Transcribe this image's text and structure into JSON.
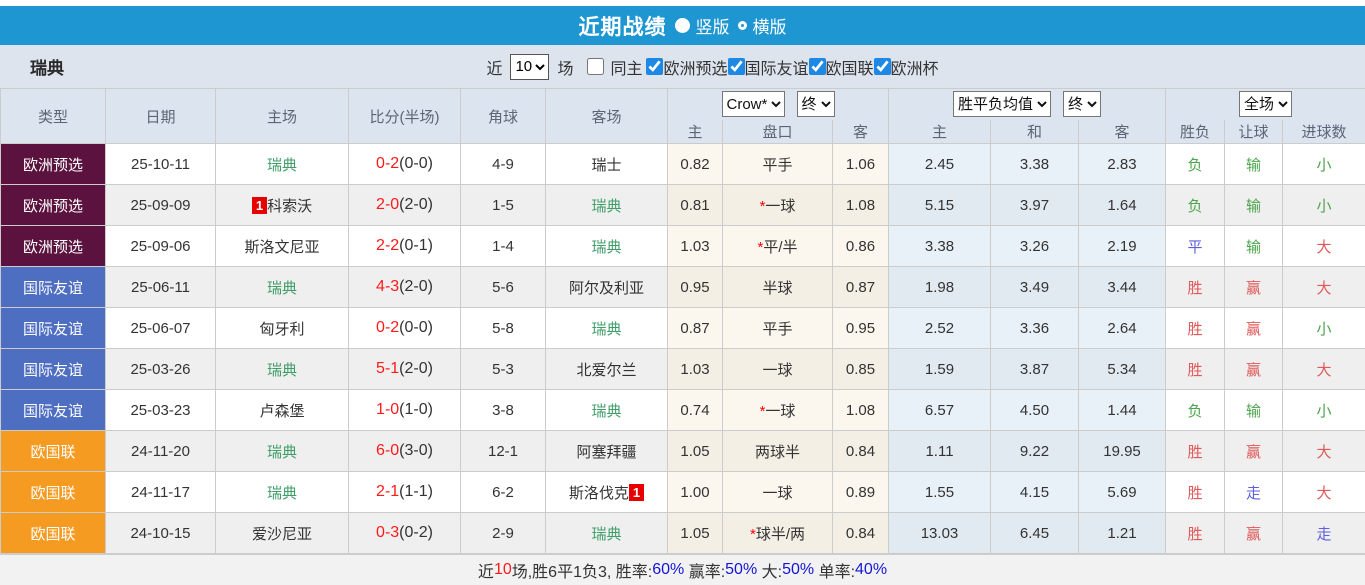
{
  "titlebar": {
    "title": "近期战绩",
    "options": [
      {
        "label": "竖版",
        "selected": true
      },
      {
        "label": "横版",
        "selected": false
      }
    ]
  },
  "filterbar": {
    "team": "瑞典",
    "recent_label": "近",
    "recent_value": "10",
    "matches_label": "场",
    "same_home": {
      "label": "同主",
      "checked": false
    },
    "competitions": [
      {
        "label": "欧洲预选",
        "checked": true
      },
      {
        "label": "国际友谊",
        "checked": true
      },
      {
        "label": "欧国联",
        "checked": true
      },
      {
        "label": "欧洲杯",
        "checked": true
      }
    ]
  },
  "table": {
    "main_headers": [
      "类型",
      "日期",
      "主场",
      "比分(半场)",
      "角球",
      "客场"
    ],
    "selects": {
      "company": "Crow*",
      "time1": "终",
      "avg": "胜平负均值",
      "time2": "终",
      "scope": "全场"
    },
    "sub_headers": [
      "主",
      "盘口",
      "客",
      "主",
      "和",
      "客",
      "胜负",
      "让球",
      "进球数"
    ],
    "type_colors": {
      "欧洲预选": "#5b123e",
      "国际友谊": "#4e6ec2",
      "欧国联": "#f59b22"
    },
    "rows": [
      {
        "type": "欧洲预选",
        "date": "25-10-11",
        "home": {
          "name": "瑞典",
          "green": true,
          "badge": null
        },
        "score": "0-2",
        "half": "(0-0)",
        "corner": "4-9",
        "away": {
          "name": "瑞士",
          "green": false,
          "badge": null
        },
        "odds_home": "0.82",
        "handicap": {
          "star": false,
          "text": "平手"
        },
        "odds_away": "1.06",
        "avg": [
          "2.45",
          "3.38",
          "2.83"
        ],
        "results": [
          {
            "t": "负",
            "c": "green"
          },
          {
            "t": "输",
            "c": "green"
          },
          {
            "t": "小",
            "c": "green"
          }
        ]
      },
      {
        "type": "欧洲预选",
        "date": "25-09-09",
        "home": {
          "name": "科索沃",
          "green": false,
          "badge": {
            "text": "1",
            "pos": "before"
          }
        },
        "score": "2-0",
        "half": "(2-0)",
        "corner": "1-5",
        "away": {
          "name": "瑞典",
          "green": true,
          "badge": null
        },
        "odds_home": "0.81",
        "handicap": {
          "star": true,
          "text": "一球"
        },
        "odds_away": "1.08",
        "avg": [
          "5.15",
          "3.97",
          "1.64"
        ],
        "results": [
          {
            "t": "负",
            "c": "green"
          },
          {
            "t": "输",
            "c": "green"
          },
          {
            "t": "小",
            "c": "green"
          }
        ]
      },
      {
        "type": "欧洲预选",
        "date": "25-09-06",
        "home": {
          "name": "斯洛文尼亚",
          "green": false,
          "badge": null
        },
        "score": "2-2",
        "half": "(0-1)",
        "corner": "1-4",
        "away": {
          "name": "瑞典",
          "green": true,
          "badge": null
        },
        "odds_home": "1.03",
        "handicap": {
          "star": true,
          "text": "平/半"
        },
        "odds_away": "0.86",
        "avg": [
          "3.38",
          "3.26",
          "2.19"
        ],
        "results": [
          {
            "t": "平",
            "c": "blue"
          },
          {
            "t": "输",
            "c": "green"
          },
          {
            "t": "大",
            "c": "red"
          }
        ]
      },
      {
        "type": "国际友谊",
        "date": "25-06-11",
        "home": {
          "name": "瑞典",
          "green": true,
          "badge": null
        },
        "score": "4-3",
        "half": "(2-0)",
        "corner": "5-6",
        "away": {
          "name": "阿尔及利亚",
          "green": false,
          "badge": null
        },
        "odds_home": "0.95",
        "handicap": {
          "star": false,
          "text": "半球"
        },
        "odds_away": "0.87",
        "avg": [
          "1.98",
          "3.49",
          "3.44"
        ],
        "results": [
          {
            "t": "胜",
            "c": "red"
          },
          {
            "t": "赢",
            "c": "red"
          },
          {
            "t": "大",
            "c": "red"
          }
        ]
      },
      {
        "type": "国际友谊",
        "date": "25-06-07",
        "home": {
          "name": "匈牙利",
          "green": false,
          "badge": null
        },
        "score": "0-2",
        "half": "(0-0)",
        "corner": "5-8",
        "away": {
          "name": "瑞典",
          "green": true,
          "badge": null
        },
        "odds_home": "0.87",
        "handicap": {
          "star": false,
          "text": "平手"
        },
        "odds_away": "0.95",
        "avg": [
          "2.52",
          "3.36",
          "2.64"
        ],
        "results": [
          {
            "t": "胜",
            "c": "red"
          },
          {
            "t": "赢",
            "c": "red"
          },
          {
            "t": "小",
            "c": "green"
          }
        ]
      },
      {
        "type": "国际友谊",
        "date": "25-03-26",
        "home": {
          "name": "瑞典",
          "green": true,
          "badge": null
        },
        "score": "5-1",
        "half": "(2-0)",
        "corner": "5-3",
        "away": {
          "name": "北爱尔兰",
          "green": false,
          "badge": null
        },
        "odds_home": "1.03",
        "handicap": {
          "star": false,
          "text": "一球"
        },
        "odds_away": "0.85",
        "avg": [
          "1.59",
          "3.87",
          "5.34"
        ],
        "results": [
          {
            "t": "胜",
            "c": "red"
          },
          {
            "t": "赢",
            "c": "red"
          },
          {
            "t": "大",
            "c": "red"
          }
        ]
      },
      {
        "type": "国际友谊",
        "date": "25-03-23",
        "home": {
          "name": "卢森堡",
          "green": false,
          "badge": null
        },
        "score": "1-0",
        "half": "(1-0)",
        "corner": "3-8",
        "away": {
          "name": "瑞典",
          "green": true,
          "badge": null
        },
        "odds_home": "0.74",
        "handicap": {
          "star": true,
          "text": "一球"
        },
        "odds_away": "1.08",
        "avg": [
          "6.57",
          "4.50",
          "1.44"
        ],
        "results": [
          {
            "t": "负",
            "c": "green"
          },
          {
            "t": "输",
            "c": "green"
          },
          {
            "t": "小",
            "c": "green"
          }
        ]
      },
      {
        "type": "欧国联",
        "date": "24-11-20",
        "home": {
          "name": "瑞典",
          "green": true,
          "badge": null
        },
        "score": "6-0",
        "half": "(3-0)",
        "corner": "12-1",
        "away": {
          "name": "阿塞拜疆",
          "green": false,
          "badge": null
        },
        "odds_home": "1.05",
        "handicap": {
          "star": false,
          "text": "两球半"
        },
        "odds_away": "0.84",
        "avg": [
          "1.11",
          "9.22",
          "19.95"
        ],
        "results": [
          {
            "t": "胜",
            "c": "red"
          },
          {
            "t": "赢",
            "c": "red"
          },
          {
            "t": "大",
            "c": "red"
          }
        ]
      },
      {
        "type": "欧国联",
        "date": "24-11-17",
        "home": {
          "name": "瑞典",
          "green": true,
          "badge": null
        },
        "score": "2-1",
        "half": "(1-1)",
        "corner": "6-2",
        "away": {
          "name": "斯洛伐克",
          "green": false,
          "badge": {
            "text": "1",
            "pos": "after"
          }
        },
        "odds_home": "1.00",
        "handicap": {
          "star": false,
          "text": "一球"
        },
        "odds_away": "0.89",
        "avg": [
          "1.55",
          "4.15",
          "5.69"
        ],
        "results": [
          {
            "t": "胜",
            "c": "red"
          },
          {
            "t": "走",
            "c": "blue"
          },
          {
            "t": "大",
            "c": "red"
          }
        ]
      },
      {
        "type": "欧国联",
        "date": "24-10-15",
        "home": {
          "name": "爱沙尼亚",
          "green": false,
          "badge": null
        },
        "score": "0-3",
        "half": "(0-2)",
        "corner": "2-9",
        "away": {
          "name": "瑞典",
          "green": true,
          "badge": null
        },
        "odds_home": "1.05",
        "handicap": {
          "star": true,
          "text": "球半/两"
        },
        "odds_away": "0.84",
        "avg": [
          "13.03",
          "6.45",
          "1.21"
        ],
        "results": [
          {
            "t": "胜",
            "c": "red"
          },
          {
            "t": "赢",
            "c": "red"
          },
          {
            "t": "走",
            "c": "blue"
          }
        ]
      }
    ]
  },
  "footer": {
    "segments": [
      {
        "t": "近",
        "c": "d"
      },
      {
        "t": "10",
        "c": "r"
      },
      {
        "t": "场,胜6平1负3, 胜率:",
        "c": "d"
      },
      {
        "t": "60%",
        "c": "b"
      },
      {
        "t": " 赢率:",
        "c": "d"
      },
      {
        "t": "50%",
        "c": "b"
      },
      {
        "t": " 大:",
        "c": "d"
      },
      {
        "t": "50%",
        "c": "b"
      },
      {
        "t": " 单率:",
        "c": "d"
      },
      {
        "t": "40%",
        "c": "b"
      }
    ]
  }
}
